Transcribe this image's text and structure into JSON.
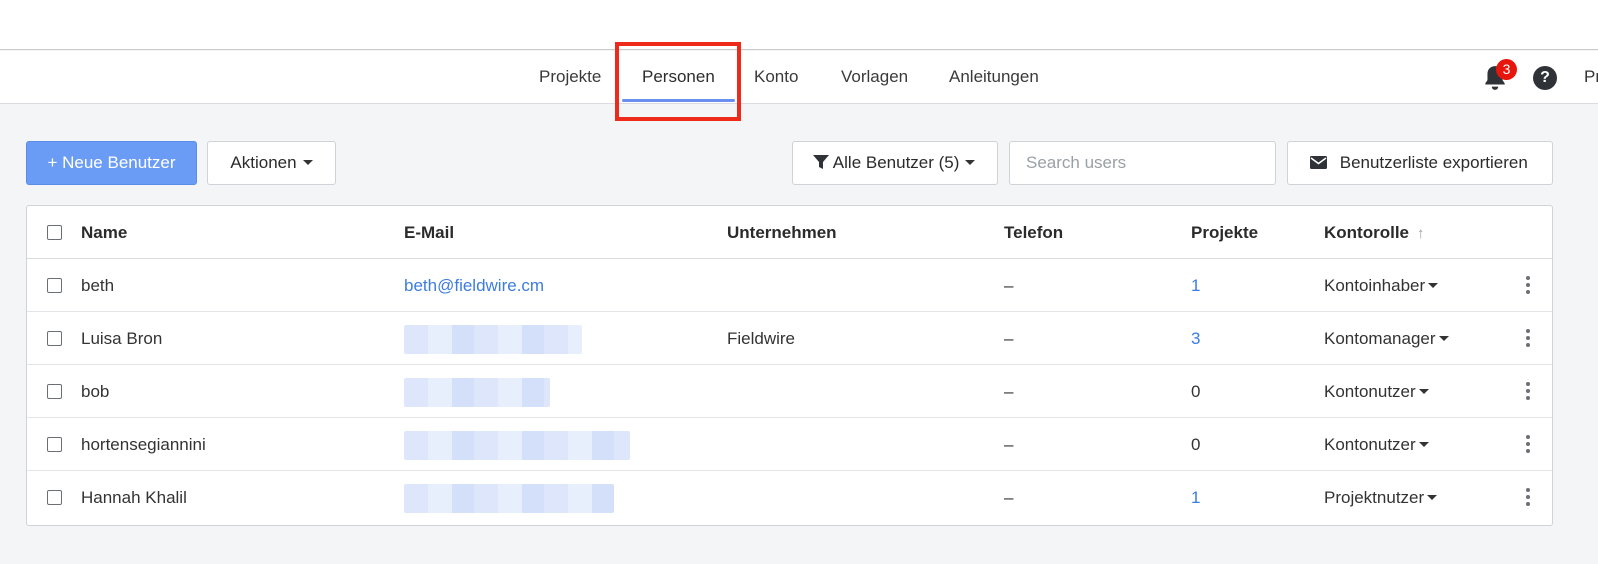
{
  "nav": {
    "tabs": [
      {
        "label": "Projekte",
        "active": false
      },
      {
        "label": "Personen",
        "active": true
      },
      {
        "label": "Konto",
        "active": false
      },
      {
        "label": "Vorlagen",
        "active": false
      },
      {
        "label": "Anleitungen",
        "active": false
      }
    ],
    "notification_count": "3",
    "help_label": "?",
    "profile_label_cut": "Pr"
  },
  "toolbar": {
    "new_user_label": "+ Neue Benutzer",
    "actions_label": "Aktionen",
    "filter_label": "Alle Benutzer (5)",
    "search_placeholder": "Search users",
    "export_label": "Benutzerliste exportieren"
  },
  "table": {
    "headers": {
      "name": "Name",
      "email": "E-Mail",
      "company": "Unternehmen",
      "phone": "Telefon",
      "projects": "Projekte",
      "role": "Kontorolle"
    },
    "rows": [
      {
        "name": "beth",
        "email": "beth@fieldwire.cm",
        "company": "",
        "phone": "–",
        "projects": "1",
        "projects_link": true,
        "role": "Kontoinhaber"
      },
      {
        "name": "Luisa Bron",
        "email": "",
        "company": "Fieldwire",
        "phone": "–",
        "projects": "3",
        "projects_link": true,
        "role": "Kontomanager"
      },
      {
        "name": "bob",
        "email": "",
        "company": "",
        "phone": "–",
        "projects": "0",
        "projects_link": false,
        "role": "Kontonutzer"
      },
      {
        "name": "hortensegiannini",
        "email": "",
        "company": "",
        "phone": "–",
        "projects": "0",
        "projects_link": false,
        "role": "Kontonutzer"
      },
      {
        "name": "Hannah Khalil",
        "email": "",
        "company": "",
        "phone": "–",
        "projects": "1",
        "projects_link": true,
        "role": "Projektnutzer"
      }
    ]
  },
  "colors": {
    "primary_button": "#6b9cf5",
    "link": "#3d7ce0",
    "highlight": "#ee2a1a",
    "badge": "#e8150c"
  }
}
